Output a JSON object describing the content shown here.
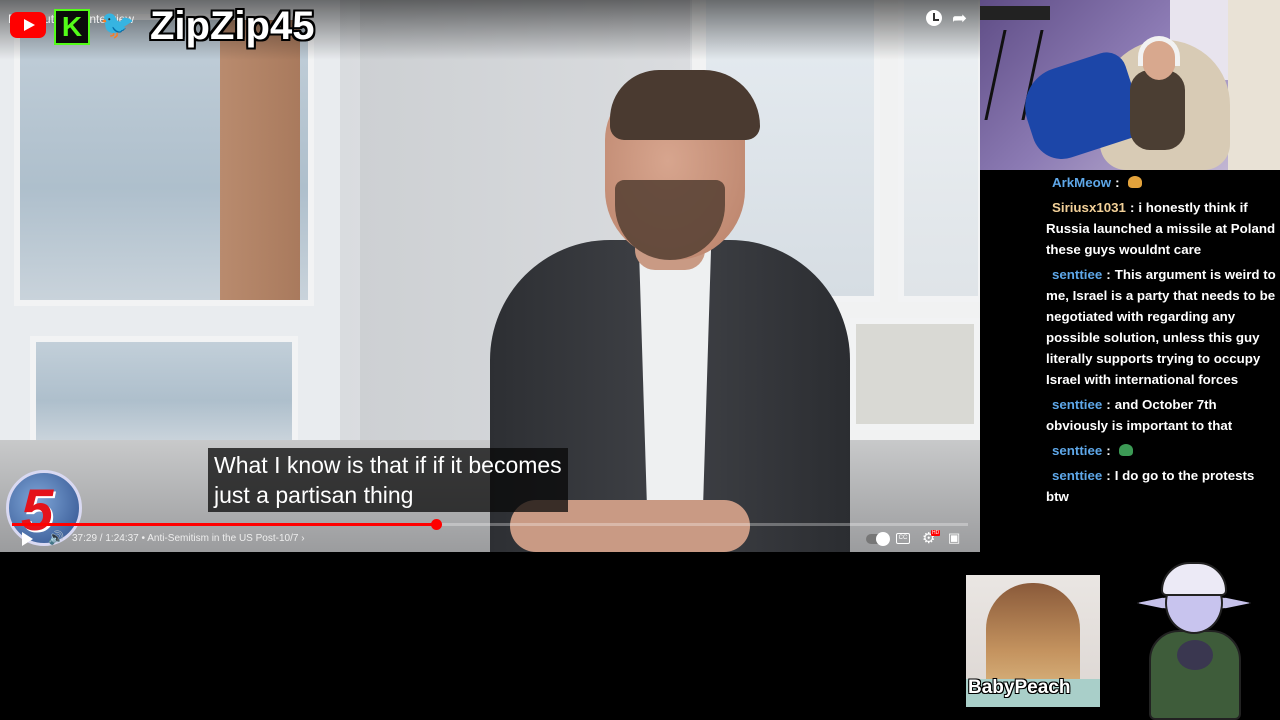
{
  "video": {
    "title": "Pete Buttigieg Interview",
    "streamer_name": "ZipZip45",
    "caption_lines": [
      "What I know is that if if it becomes",
      "just a partisan thing"
    ],
    "time": "37:29 / 1:24:37",
    "chapter": "• Anti-Semitism in the US Post-10/7 ›",
    "progress": 0.443,
    "channel_badge": "5",
    "hd_badge": "HD",
    "cc_label": "CC",
    "icons": {
      "youtube": "youtube-logo-icon",
      "kick": "kick-logo-icon",
      "twitter": "twitter-bird-icon",
      "watch_later": "clock-icon",
      "share": "share-arrow-icon",
      "play": "play-icon",
      "volume": "volume-icon",
      "settings": "gear-icon",
      "fullscreen": "exit-fullscreen-icon"
    },
    "kick_letter": "K",
    "colors": {
      "progress": "#ff0000",
      "youtube": "#ff0000",
      "kick": "#53fc18",
      "twitter": "#1da1f2"
    }
  },
  "chat": {
    "messages": [
      {
        "user": "ArkMeow",
        "color": "#5ea7e8",
        "sep": ":",
        "text": "",
        "emote": "#e3a33c"
      },
      {
        "user": "Siriusx1031",
        "color": "#f2d098",
        "sep": ":",
        "text": "i honestly think if Russia launched a missile at Poland these guys wouldnt care",
        "emote": ""
      },
      {
        "user": "senttiee",
        "color": "#5ea7e8",
        "sep": ":",
        "text": "This argument is weird to me, Israel is a party that needs to be negotiated with regarding any possible solution, unless this guy literally supports trying to occupy Israel with international forces",
        "emote": ""
      },
      {
        "user": "senttiee",
        "color": "#5ea7e8",
        "sep": ":",
        "text": "and October 7th obviously is important to that",
        "emote": ""
      },
      {
        "user": "senttiee",
        "color": "#5ea7e8",
        "sep": ":",
        "text": "",
        "emote": "#3c9a55"
      },
      {
        "user": "senttiee",
        "color": "#5ea7e8",
        "sep": ":",
        "text": "I do go to the protests btw",
        "emote": ""
      }
    ]
  },
  "guest": {
    "name": "BabyPeach"
  }
}
